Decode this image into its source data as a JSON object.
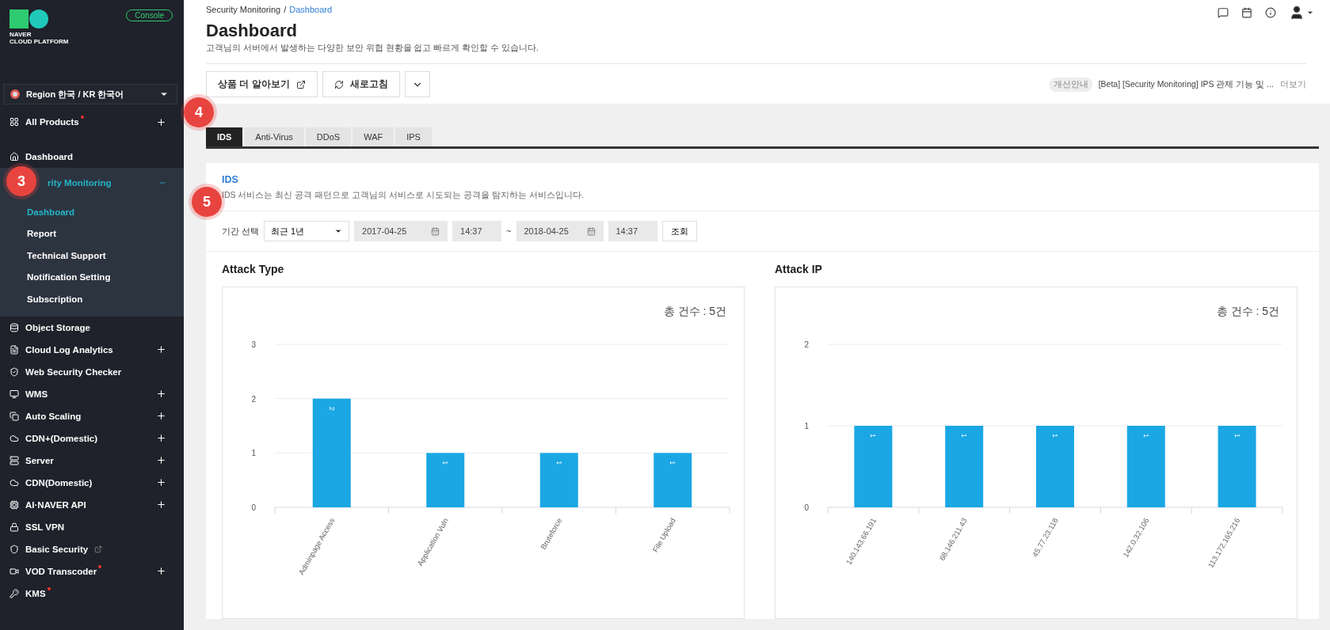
{
  "sidebar": {
    "logo": {
      "line1": "NAVER",
      "line2": "CLOUD PLATFORM"
    },
    "console_button": "Console",
    "region": "Region 한국 / KR 한국어",
    "items": [
      {
        "label": "All Products",
        "badge": true,
        "expandable": true,
        "expanded": false,
        "selected": false
      },
      {
        "label": "Dashboard",
        "badge": false,
        "expandable": false,
        "expanded": false,
        "selected": false
      },
      {
        "label": "rity Monitoring",
        "badge": false,
        "expandable": true,
        "expanded": true,
        "selected": true,
        "callout": "3",
        "children": [
          {
            "label": "Dashboard",
            "selected": true
          },
          {
            "label": "Report",
            "selected": false
          },
          {
            "label": "Technical Support",
            "selected": false
          },
          {
            "label": "Notification Setting",
            "selected": false
          },
          {
            "label": "Subscription",
            "selected": false
          }
        ]
      },
      {
        "label": "Object Storage",
        "badge": false,
        "expandable": false,
        "expanded": false,
        "selected": false
      },
      {
        "label": "Cloud Log Analytics",
        "badge": false,
        "expandable": true,
        "expanded": false,
        "selected": false
      },
      {
        "label": "Web Security Checker",
        "badge": false,
        "expandable": false,
        "expanded": false,
        "selected": false
      },
      {
        "label": "WMS",
        "badge": false,
        "expandable": true,
        "expanded": false,
        "selected": false
      },
      {
        "label": "Auto Scaling",
        "badge": false,
        "expandable": true,
        "expanded": false,
        "selected": false
      },
      {
        "label": "CDN+(Domestic)",
        "badge": false,
        "expandable": true,
        "expanded": false,
        "selected": false
      },
      {
        "label": "Server",
        "badge": false,
        "expandable": true,
        "expanded": false,
        "selected": false
      },
      {
        "label": "CDN(Domestic)",
        "badge": false,
        "expandable": true,
        "expanded": false,
        "selected": false
      },
      {
        "label": "AI·NAVER API",
        "badge": false,
        "expandable": true,
        "expanded": false,
        "selected": false
      },
      {
        "label": "SSL VPN",
        "badge": false,
        "expandable": false,
        "expanded": false,
        "selected": false
      },
      {
        "label": "Basic Security",
        "badge": false,
        "expandable": false,
        "expanded": false,
        "selected": false,
        "external": true
      },
      {
        "label": "VOD Transcoder",
        "badge": true,
        "expandable": true,
        "expanded": false,
        "selected": false
      },
      {
        "label": "KMS",
        "badge": true,
        "expandable": false,
        "expanded": false,
        "selected": false
      }
    ]
  },
  "header": {
    "breadcrumb": {
      "items": [
        "Security Monitoring",
        "Dashboard"
      ],
      "separator": "/"
    },
    "title": "Dashboard",
    "subtitle": "고객님의 서버에서 발생하는 다양한 보안 위협 현황을 쉽고 빠르게 확인할 수 있습니다."
  },
  "toolbar": {
    "buttons": [
      {
        "label": "상품 더 알아보기",
        "kind": "external"
      },
      {
        "label": "새로고침",
        "kind": "refresh"
      },
      {
        "kind": "dropdown"
      }
    ],
    "notice": {
      "tag": "개선안내",
      "text": "[Beta] [Security Monitoring] IPS 관제 기능 및 ...",
      "more": "더보기"
    }
  },
  "tabs": {
    "callout": "4",
    "items": [
      {
        "label": "IDS",
        "selected": true
      },
      {
        "label": "Anti-Virus",
        "selected": false
      },
      {
        "label": "DDoS",
        "selected": false
      },
      {
        "label": "WAF",
        "selected": false
      },
      {
        "label": "IPS",
        "selected": false
      }
    ]
  },
  "section": {
    "title": "IDS",
    "description": "IDS 서비스는 최신 공격 패턴으로 고객님의 서비스로 시도되는 공격을 탐지하는 서비스입니다.",
    "callout": "5"
  },
  "filter": {
    "label": "기간 선택",
    "period": "최근 1년",
    "start_date": "2017-04-25",
    "start_time": "14:37",
    "separator": "~",
    "end_date": "2018-04-25",
    "end_time": "14:37",
    "search_button": "조회"
  },
  "charts": [
    {
      "title": "Attack Type",
      "total": "총 건수 : 5건",
      "chart_data": {
        "type": "bar",
        "categories": [
          "Adminpage Access",
          "Application Vuln",
          "Bruteforce",
          "File Upload"
        ],
        "series": [
          {
            "color": "#1aa7e4",
            "values": [
              2,
              1,
              1,
              1
            ]
          }
        ],
        "ylim": [
          0,
          3
        ],
        "yticks": [
          0,
          1,
          2,
          3
        ],
        "data_labels": true
      }
    },
    {
      "title": "Attack IP",
      "total": "총 건수 : 5건",
      "chart_data": {
        "type": "bar",
        "categories": [
          "140.143.66.191",
          "68.146.211.43",
          "45.77.23.118",
          "142.0.32.106",
          "113.172.165.216"
        ],
        "series": [
          {
            "color": "#1aa7e4",
            "values": [
              1,
              1,
              1,
              1,
              1
            ]
          }
        ],
        "ylim": [
          0,
          2
        ],
        "yticks": [
          0,
          1,
          2
        ],
        "data_labels": true
      }
    }
  ]
}
